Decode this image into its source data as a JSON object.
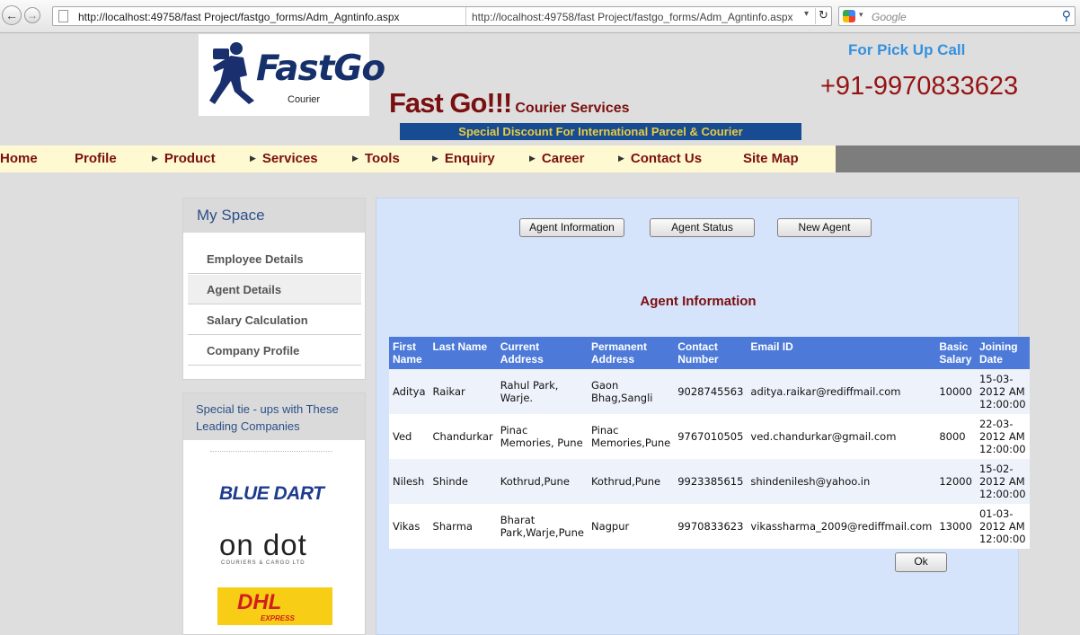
{
  "browser": {
    "url": "http://localhost:49758/fast Project/fastgo_forms/Adm_Agntinfo.aspx",
    "url_echo": "http://localhost:49758/fast Project/fastgo_forms/Adm_Agntinfo.aspx",
    "search_placeholder": "Google"
  },
  "header": {
    "logo_text": "FastGo",
    "logo_sub": "Courier",
    "brand_main": "Fast Go!!!",
    "brand_sub": "Courier Services",
    "promo": "Special Discount For International Parcel  & Courier",
    "pickup_label": "For Pick Up Call",
    "phone": "+91-9970833623"
  },
  "menu": {
    "items": [
      "Home",
      "Profile",
      "Product",
      "Services",
      "Tools",
      "Enquiry",
      "Career",
      "Contact Us",
      "Site Map"
    ]
  },
  "sidebar": {
    "title": "My Space",
    "items": [
      "Employee Details",
      "Agent Details",
      "Salary Calculation",
      "Company Profile"
    ],
    "partners_title": "Special tie - ups with These Leading Companies",
    "partners": [
      "BLUE DART",
      "on dot",
      "COURIERS & CARGO LTD",
      "DHL",
      "EXPRESS"
    ]
  },
  "main": {
    "buttons": [
      "Agent Information",
      "Agent Status",
      "New Agent"
    ],
    "title": "Agent Information",
    "columns": [
      "First Name",
      "Last Name",
      "Current Address",
      "Permanent Address",
      "Contact Number",
      "Email ID",
      "Basic Salary",
      "Joining Date"
    ],
    "rows": [
      [
        "Aditya",
        "Raikar",
        "Rahul Park, Warje.",
        "Gaon Bhag,Sangli",
        "9028745563",
        "aditya.raikar@rediffmail.com",
        "10000",
        "15-03-2012 AM 12:00:00"
      ],
      [
        "Ved",
        "Chandurkar",
        "Pinac Memories, Pune",
        "Pinac Memories,Pune",
        "9767010505",
        "ved.chandurkar@gmail.com",
        "8000",
        "22-03-2012 AM 12:00:00"
      ],
      [
        "Nilesh",
        "Shinde",
        "Kothrud,Pune",
        "Kothrud,Pune",
        "9923385615",
        "shindenilesh@yahoo.in",
        "12000",
        "15-02-2012 AM 12:00:00"
      ],
      [
        "Vikas",
        "Sharma",
        "Bharat Park,Warje,Pune",
        "Nagpur",
        "9970833623",
        "vikassharma_2009@rediffmail.com",
        "13000",
        "01-03-2012 AM 12:00:00"
      ]
    ],
    "ok_label": "Ok"
  },
  "colors": {
    "brand": "#7a0f0f",
    "header_blue": "#4d7ad8",
    "promo_bg": "#174c93",
    "promo_text": "#e9cc40",
    "panel_bg": "#d5e3fb"
  }
}
